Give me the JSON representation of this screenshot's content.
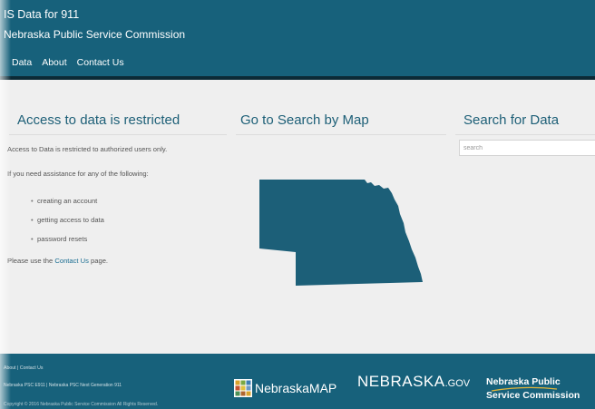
{
  "header": {
    "title": "IS Data for 911",
    "subtitle": "Nebraska Public Service Commission",
    "nav": [
      "Data",
      "About",
      "Contact Us"
    ]
  },
  "restricted": {
    "title": "Access to data is restricted",
    "intro": "Access to Data is restricted to authorized users only.",
    "assist": "If you need assistance for any of the following:",
    "items": [
      "creating an account",
      "getting access to data",
      "password resets"
    ],
    "contact_prefix": "Please use the ",
    "contact_link": "Contact Us",
    "contact_suffix": " page."
  },
  "map": {
    "title": "Go to Search by Map",
    "region_icon": "nebraska-state-map"
  },
  "search": {
    "title": "Search for Data",
    "placeholder": "search",
    "value": ""
  },
  "footer": {
    "link_about": "About",
    "link_separator": "|",
    "link_contact": "Contact Us",
    "line2": "Nebraska PSC E911   |   Nebraska PSC Next Generation 911",
    "copyright": "Copyright © 2016 Nebraska Public Service Commission All Rights Reserved.",
    "logo_nebraskamap": "NebraskaMAP",
    "logo_nebraska_gov_main": "NEBRASKA",
    "logo_nebraska_gov_suffix": ".GOV",
    "logo_psc_line1": "Nebraska Public",
    "logo_psc_line2": "Service Commission"
  },
  "colors": {
    "brand": "#17617b",
    "map_fill": "#1c5f78",
    "title_text": "#1d5f77",
    "background": "#efefef"
  }
}
